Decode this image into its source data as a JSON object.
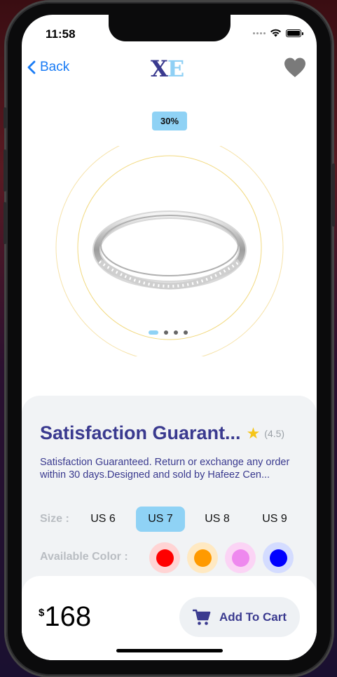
{
  "status_bar": {
    "time": "11:58"
  },
  "nav": {
    "back_label": "Back",
    "logo_x": "X",
    "logo_e": "E"
  },
  "product": {
    "discount": "30%",
    "title": "Satisfaction Guarant...",
    "rating": "(4.5)",
    "description": "Satisfaction Guaranteed. Return or exchange any order within 30 days.Designed and sold by Hafeez Cen...",
    "image_pages": 4,
    "current_page": 1
  },
  "size": {
    "label": "Size :",
    "options": [
      "US 6",
      "US 7",
      "US 8",
      "US 9"
    ],
    "selected": "US 7"
  },
  "color": {
    "label": "Available Color :",
    "options": [
      {
        "color": "#ff0000",
        "halo": "#ffd4d4"
      },
      {
        "color": "#ff9a00",
        "halo": "#ffe9c2"
      },
      {
        "color": "#ee88ee",
        "halo": "#fbd4f5"
      },
      {
        "color": "#0000ff",
        "halo": "#d4dcff"
      }
    ]
  },
  "footer": {
    "currency": "$",
    "price": "168",
    "add_to_cart_label": "Add To Cart"
  },
  "theme": {
    "accent_blue": "#8fd2f5",
    "brand_navy": "#3a3a8f",
    "link_blue": "#1a7cf5"
  }
}
